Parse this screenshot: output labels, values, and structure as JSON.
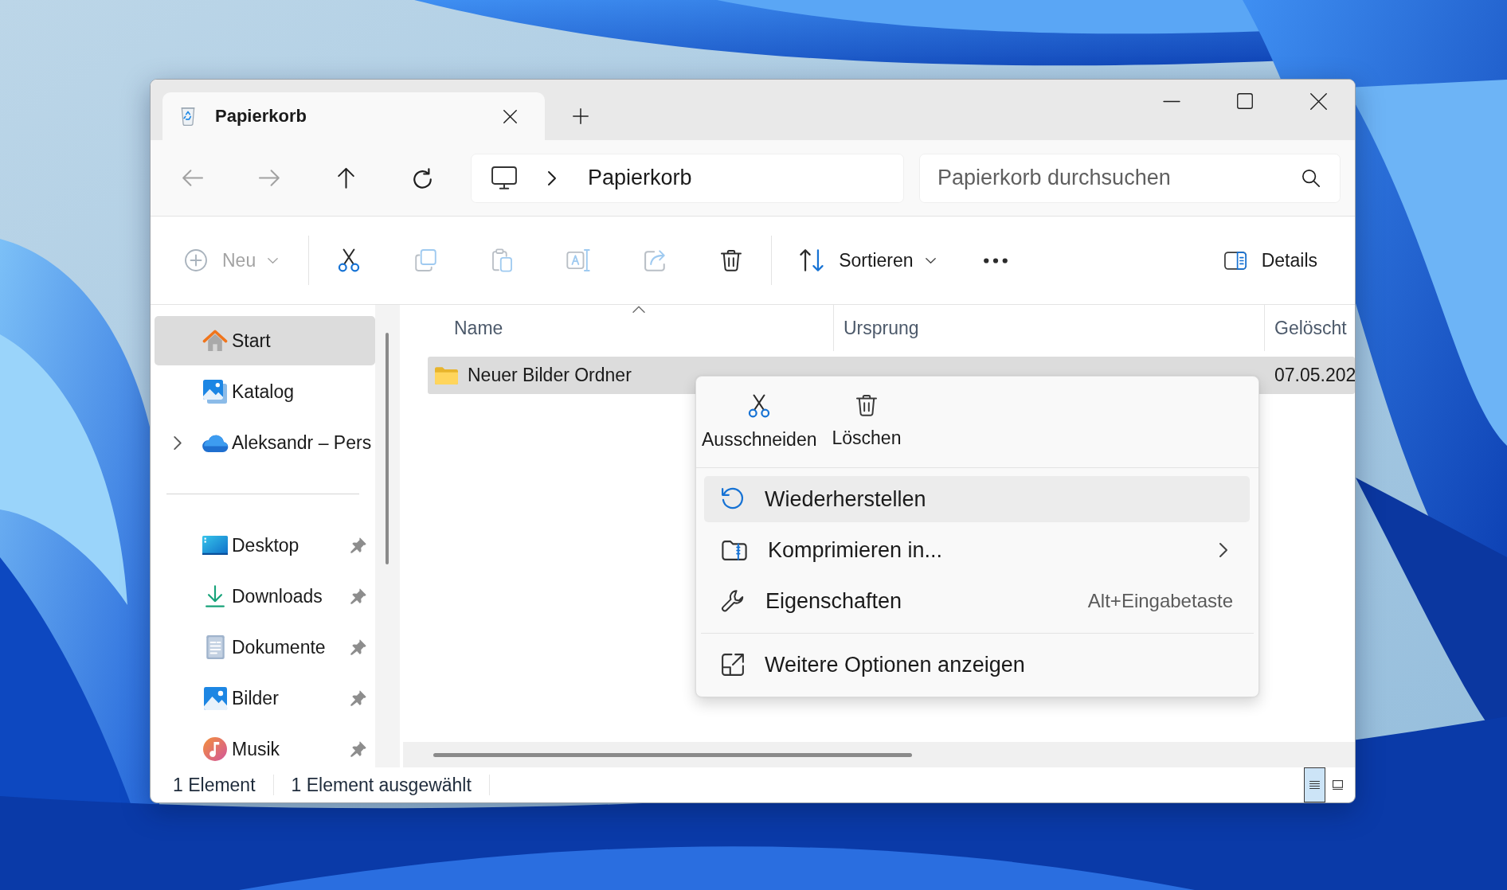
{
  "tabs": [
    {
      "label": "Papierkorb",
      "selected": true
    }
  ],
  "navigation": [
    {
      "kind": "back",
      "disabled": true
    },
    {
      "kind": "forward",
      "disabled": true
    },
    {
      "kind": "up",
      "disabled": false
    },
    {
      "kind": "refresh",
      "disabled": false
    }
  ],
  "address_bar": {
    "path": [
      "Papierkorb"
    ]
  },
  "search": {
    "placeholder": "Papierkorb durchsuchen"
  },
  "toolbar": {
    "groups": [
      {
        "items": [
          {
            "kind": "new",
            "label": "Neu",
            "disabled": true
          }
        ]
      },
      {
        "items": [
          {
            "kind": "cut",
            "disabled": false
          },
          {
            "kind": "copy",
            "disabled": true
          },
          {
            "kind": "paste",
            "disabled": true
          },
          {
            "kind": "rename",
            "disabled": true
          },
          {
            "kind": "share",
            "disabled": true
          },
          {
            "kind": "delete",
            "disabled": false
          }
        ]
      },
      {
        "items": [
          {
            "kind": "sort",
            "label": "Sortieren",
            "disabled": false
          },
          {
            "kind": "more",
            "disabled": false
          }
        ]
      }
    ],
    "details": {
      "label": "Details"
    }
  },
  "sidebar": {
    "sections": [
      {
        "items": [
          {
            "kind": "home",
            "label": "Start",
            "selected": true,
            "expandable": false,
            "pinned": false
          },
          {
            "kind": "gallery",
            "label": "Katalog",
            "selected": false,
            "expandable": false,
            "pinned": false
          },
          {
            "kind": "cloud",
            "label": "Aleksandr – Pers",
            "selected": false,
            "expandable": true,
            "pinned": false
          }
        ]
      },
      {
        "items": [
          {
            "kind": "desktop",
            "label": "Desktop",
            "selected": false,
            "expandable": false,
            "pinned": true
          },
          {
            "kind": "downloads",
            "label": "Downloads",
            "selected": false,
            "expandable": false,
            "pinned": true
          },
          {
            "kind": "documents",
            "label": "Dokumente",
            "selected": false,
            "expandable": false,
            "pinned": true
          },
          {
            "kind": "pictures",
            "label": "Bilder",
            "selected": false,
            "expandable": false,
            "pinned": true
          },
          {
            "kind": "music",
            "label": "Musik",
            "selected": false,
            "expandable": false,
            "pinned": true
          }
        ]
      }
    ]
  },
  "table": {
    "columns": [
      {
        "label": "Name",
        "sorted": true
      },
      {
        "label": "Ursprung",
        "sorted": false
      },
      {
        "label": "Gelöscht",
        "sorted": false
      }
    ],
    "rows": [
      {
        "kind": "folder",
        "name": "Neuer Bilder Ordner",
        "deleted": "07.05.202",
        "selected": true
      }
    ]
  },
  "context_menu": {
    "quick_actions": [
      {
        "kind": "cut",
        "label": "Ausschneiden"
      },
      {
        "kind": "delete",
        "label": "Löschen"
      }
    ],
    "sections": [
      {
        "items": [
          {
            "kind": "restore",
            "label": "Wiederherstellen",
            "selected": true,
            "submenu": false
          },
          {
            "kind": "compress",
            "label": "Komprimieren in...",
            "selected": false,
            "submenu": true
          },
          {
            "kind": "properties",
            "label": "Eigenschaften",
            "shortcut": "Alt+Eingabetaste",
            "selected": false,
            "submenu": false
          }
        ]
      },
      {
        "items": [
          {
            "kind": "more_options",
            "label": "Weitere Optionen anzeigen",
            "selected": false,
            "submenu": false
          }
        ]
      }
    ]
  },
  "status_bar": {
    "items": [
      "1 Element",
      "1 Element ausgewählt"
    ],
    "views": [
      {
        "kind": "details",
        "selected": true
      },
      {
        "kind": "tiles",
        "selected": false
      }
    ]
  }
}
